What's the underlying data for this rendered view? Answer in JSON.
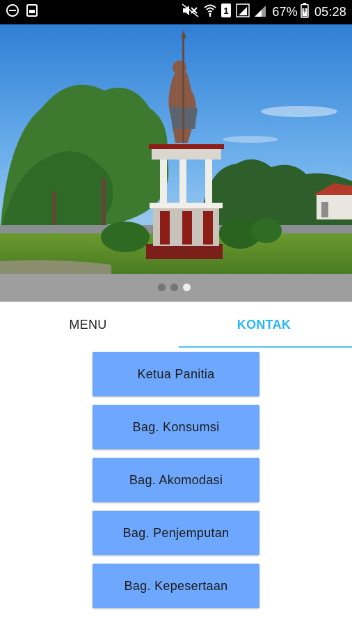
{
  "status_bar": {
    "left_icons": [
      "do-not-disturb-icon",
      "gallery-icon"
    ],
    "right_icons": [
      "mute-icon",
      "wifi-icon",
      "sim-1-icon",
      "signal-1-icon",
      "signal-2-icon",
      "battery-icon"
    ],
    "battery": "67%",
    "time": "05:28",
    "sim_label": "1"
  },
  "banner": {
    "image_name": "monument-photo",
    "pager": {
      "count": 3,
      "active_index": 2
    }
  },
  "tabs": [
    {
      "label": "MENU",
      "selected": false
    },
    {
      "label": "KONTAK",
      "selected": true
    }
  ],
  "contacts": [
    {
      "label": "Ketua Panitia"
    },
    {
      "label": "Bag. Konsumsi"
    },
    {
      "label": "Bag. Akomodasi"
    },
    {
      "label": "Bag. Penjemputan"
    },
    {
      "label": "Bag. Kepesertaan"
    }
  ],
  "colors": {
    "status_bar_bg": "#000000",
    "pager_bg": "#9e9e9e",
    "tab_active": "#29b6f6",
    "tab_indicator": "#4fc3f7",
    "button_bg": "#6ea8fe"
  }
}
